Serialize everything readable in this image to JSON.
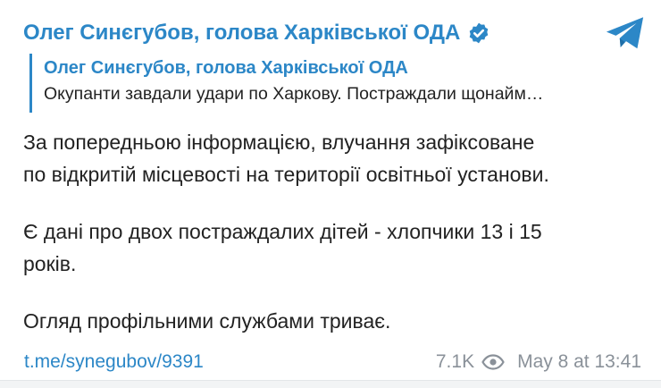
{
  "post": {
    "channel_name": "Олег Синєгубов, голова Харківської ОДА",
    "reply": {
      "author": "Олег Синєгубов, голова Харківської ОДА",
      "text": "Окупанти завдали удари по Харкову. Постраждали щонайм…"
    },
    "lines": [
      "За попередньою інформацією, влучання зафіксоване",
      "по відкритій місцевості на території освітньої установи.",
      "Є дані про двох постраждалих дітей - хлопчики 13 і 15",
      "років.",
      "Огляд профільними службами триває."
    ],
    "link": "t.me/synegubov/9391",
    "views": "7.1K",
    "timestamp": "May 8 at 13:41"
  },
  "colors": {
    "accent": "#2c87c7",
    "text": "#222222",
    "meta": "#8a9199"
  },
  "icons": {
    "verified": "verified-badge-icon",
    "telegram": "telegram-plane-icon",
    "views": "eye-icon"
  }
}
